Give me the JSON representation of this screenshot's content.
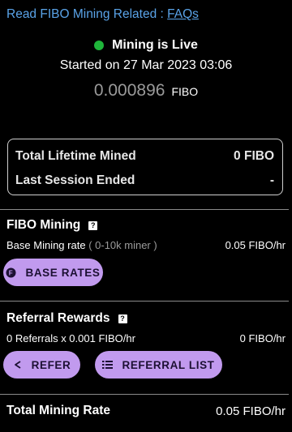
{
  "faq": {
    "prefix": "Read FIBO Mining Related : ",
    "link": "FAQs"
  },
  "status": {
    "live_label": "Mining is Live",
    "started": "Started on 27 Mar 2023 03:06",
    "balance": "0.000896",
    "unit": "FIBO",
    "live_color": "#1fb53a"
  },
  "summary": {
    "lifetime_label": "Total Lifetime Mined",
    "lifetime_value": "0 FIBO",
    "session_label": "Last Session Ended",
    "session_value": "-"
  },
  "fibo_mining": {
    "title": "FIBO Mining",
    "help": "?",
    "rate_label": "Base Mining rate",
    "rate_note": "( 0-10k miner )",
    "rate_value": "0.05 FIBO/hr",
    "base_rates_button": "BASE RATES"
  },
  "referral": {
    "title": "Referral Rewards",
    "help": "?",
    "formula": "0 Referrals x 0.001 FIBO/hr",
    "value": "0 FIBO/hr",
    "refer_button": "REFER",
    "list_button": "REFERRAL LIST"
  },
  "total": {
    "label": "Total Mining Rate",
    "value": "0.05 FIBO/hr"
  },
  "colors": {
    "accent": "#c19aee",
    "link": "#5aa3e8",
    "background": "#000000"
  }
}
